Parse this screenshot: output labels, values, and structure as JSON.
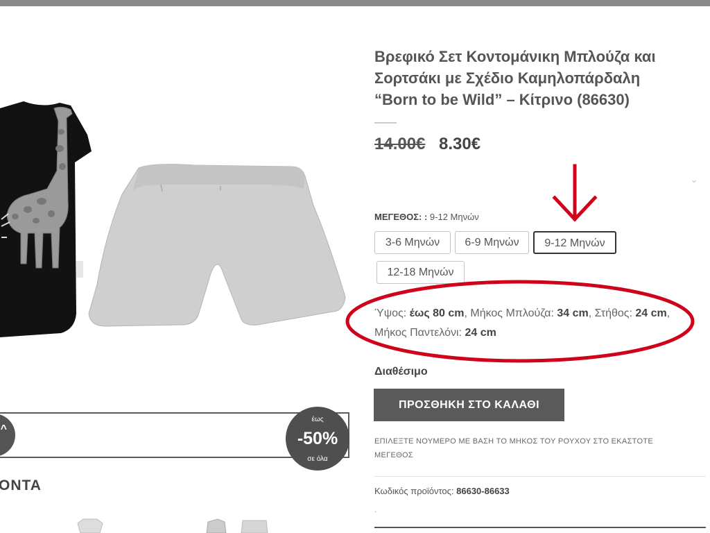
{
  "product": {
    "title_lines": [
      "Βρεφικό Σετ Κοντομάνικη Μπλούζα και",
      "Σορτσάκι με Σχέδιο Καμηλοπάρδαλη",
      "“Born to be Wild” – Κίτρινο (86630)"
    ],
    "price_old": "14.00€",
    "price_new": "8.30€",
    "size_label": "ΜΕΓΕΘΟΣ: :",
    "size_selected": "9-12 Μηνών",
    "sizes": [
      "3-6 Μηνών",
      "6-9 Μηνών",
      "9-12 Μηνών",
      "12-18 Μηνών"
    ],
    "dimensions": {
      "height_label": "Ύψος:",
      "height_value": "έως 80 cm",
      "shirt_label": ", Μήκος Μπλούζα:",
      "shirt_value": "34 cm",
      "chest_label": ", Στήθος:",
      "chest_value": "24 cm",
      "pants_label": ", Μήκος Παντελόνι:",
      "pants_value": "24 cm"
    },
    "availability": "Διαθέσιμο",
    "add_to_cart": "ΠΡΟΣΘΗΚΗ ΣΤΟ ΚΑΛΑΘΙ",
    "note": "ΕΠΙΛΕΞΤΕ ΝΟΥΜΕΡΟ ΜΕ ΒΑΣΗ ΤΟ ΜΗΚΟΣ ΤΟΥ ΡΟΥΧΟΥ ΣΤΟ ΕΚΑΣΤΟΤΕ ΜΕΓΕΘΟΣ",
    "sku_label": "Κωδικός προϊόντος:",
    "sku_value": "86630-86633",
    "dot": "."
  },
  "promo": {
    "left_symbol": "^",
    "badge_top": "έως",
    "badge_value": "-50%",
    "badge_bottom": "σε όλα"
  },
  "section": {
    "title": "ΟΝΤΑ"
  },
  "colors": {
    "annotation_red": "#d0021b",
    "button_gray": "#5a5a5a"
  },
  "icons": {
    "annotation": "down-arrow",
    "dropdown": "chevron-down-icon"
  }
}
